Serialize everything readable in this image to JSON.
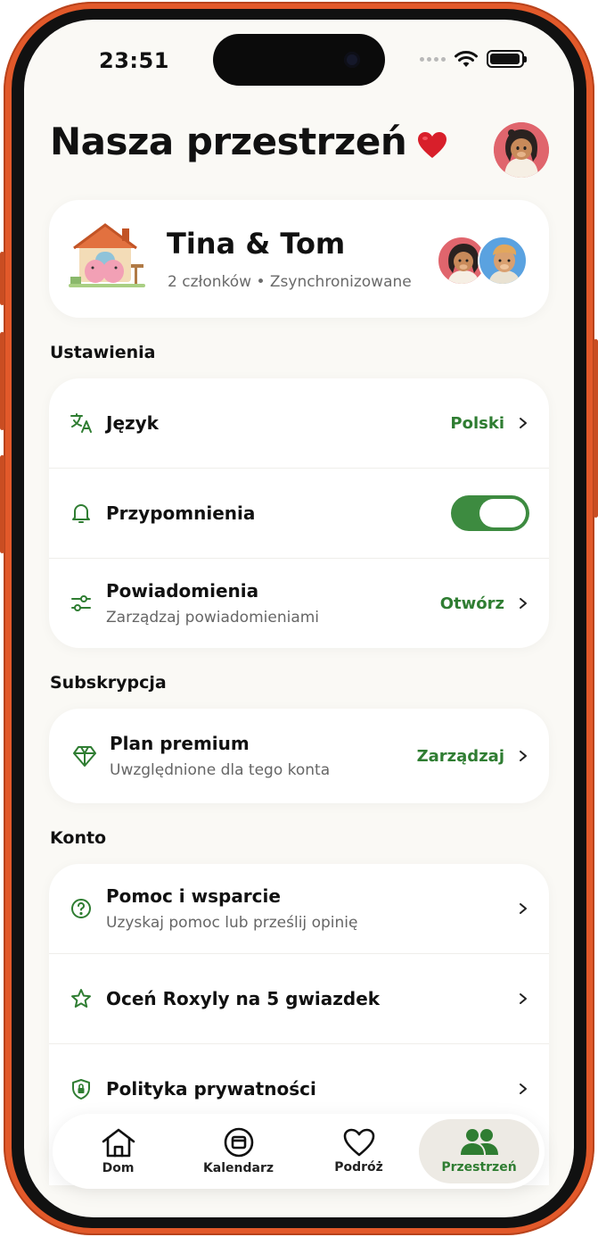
{
  "status_bar": {
    "time": "23:51"
  },
  "header": {
    "title": "Nasza przestrzeń"
  },
  "couple": {
    "name": "Tina & Tom",
    "meta": "2 członków • Zsynchronizowane"
  },
  "sections": {
    "settings": "Ustawienia",
    "subscription": "Subskrypcja",
    "account": "Konto"
  },
  "settings_rows": {
    "language": {
      "title": "Język",
      "value": "Polski"
    },
    "reminders": {
      "title": "Przypomnienia",
      "enabled": true
    },
    "notifications": {
      "title": "Powiadomienia",
      "subtitle": "Zarządzaj powiadomieniami",
      "value": "Otwórz"
    }
  },
  "subscription_row": {
    "title": "Plan premium",
    "subtitle": "Uwzględnione dla tego konta",
    "value": "Zarządzaj"
  },
  "account_rows": {
    "help": {
      "title": "Pomoc i wsparcie",
      "subtitle": "Uzyskaj pomoc lub prześlij opinię"
    },
    "rate": {
      "title": "Oceń Roxyly na 5 gwiazdek"
    },
    "privacy": {
      "title": "Polityka prywatności"
    }
  },
  "tabbar": {
    "tabs": [
      {
        "label": "Dom",
        "icon": "house-icon"
      },
      {
        "label": "Kalendarz",
        "icon": "calendar-icon"
      },
      {
        "label": "Podróż",
        "icon": "heart-icon"
      },
      {
        "label": "Przestrzeń",
        "icon": "people-icon",
        "active": true
      }
    ]
  },
  "colors": {
    "accent": "#2f7d32",
    "frame": "#e2592a",
    "background": "#faf9f5"
  }
}
